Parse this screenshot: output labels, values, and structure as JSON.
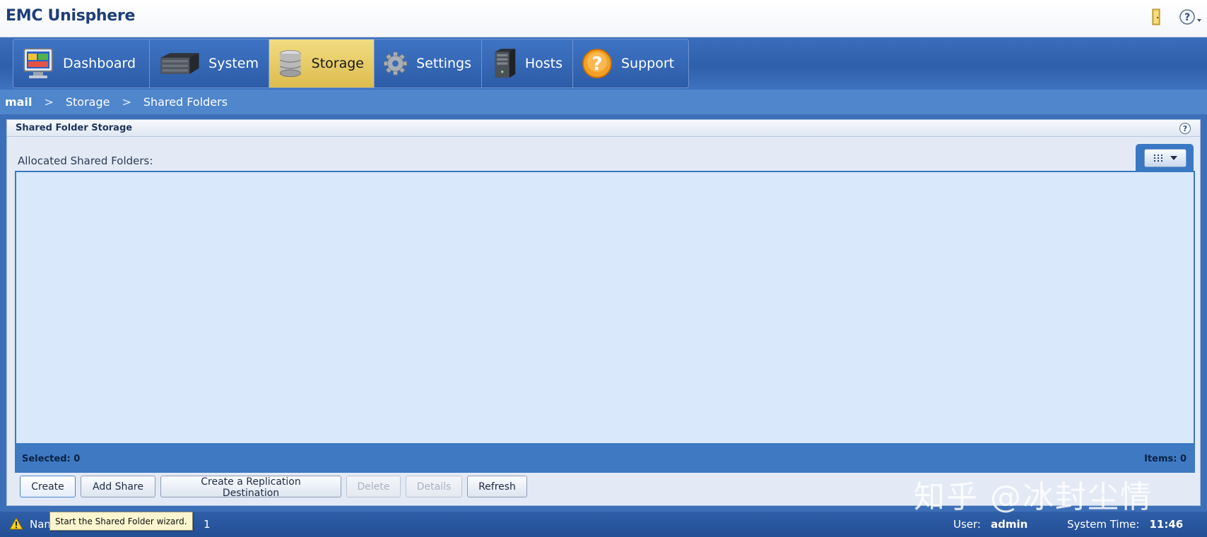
{
  "app": {
    "title": "EMC Unisphere"
  },
  "header_icons": {
    "logout_icon": "door-icon",
    "help_icon": "help-dropdown-icon"
  },
  "nav": {
    "tabs": [
      {
        "label": "Dashboard",
        "icon": "monitor-icon",
        "active": false
      },
      {
        "label": "System",
        "icon": "server-rack-icon",
        "active": false
      },
      {
        "label": "Storage",
        "icon": "disk-stack-icon",
        "active": true
      },
      {
        "label": "Settings",
        "icon": "gear-icon",
        "active": false
      },
      {
        "label": "Hosts",
        "icon": "tower-pc-icon",
        "active": false
      },
      {
        "label": "Support",
        "icon": "question-icon",
        "active": false
      }
    ]
  },
  "breadcrumb": {
    "root": "mail",
    "sep": ">",
    "level1": "Storage",
    "level2": "Shared Folders"
  },
  "panel": {
    "title": "Shared Folder Storage",
    "section_label": "Allocated Shared Folders:",
    "selected": "Selected: 0",
    "items": "Items: 0"
  },
  "actions": {
    "create": "Create",
    "add_share": "Add Share",
    "create_replication": "Create a Replication Destination",
    "delete": "Delete",
    "details": "Details",
    "refresh": "Refresh"
  },
  "tooltip": {
    "text": "Start the Shared Folder wizard."
  },
  "status": {
    "text_prefix": "Nan",
    "count": "1",
    "user_label": "User:",
    "user_value": "admin",
    "time_label": "System Time:",
    "time_value": "11:46"
  },
  "watermark": "知乎 @冰封尘情",
  "colors": {
    "nav_blue": "#2f5fa9",
    "active_tab": "#e8cc63",
    "grid_bg": "#d9e8fb",
    "footer_blue": "#3f79c2"
  }
}
